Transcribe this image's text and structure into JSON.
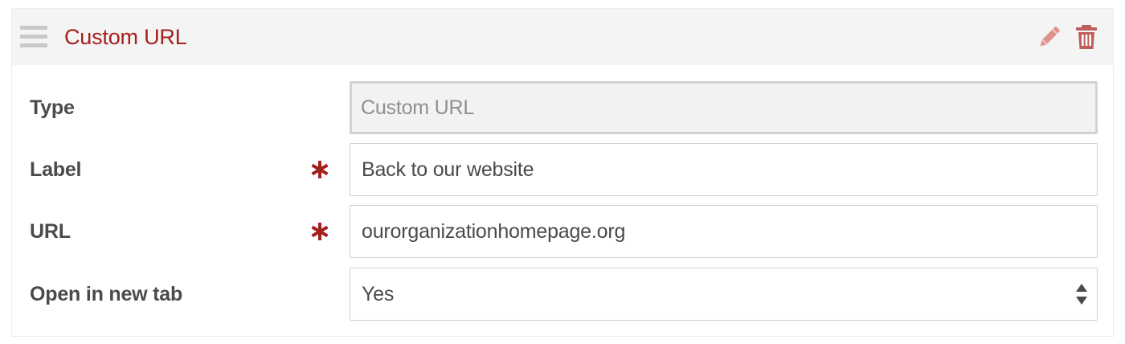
{
  "panel": {
    "title": "Custom URL",
    "icons": {
      "drag": "drag-handle-icon",
      "edit": "pencil-icon",
      "delete": "trash-icon"
    }
  },
  "fields": {
    "type": {
      "label": "Type",
      "value": "Custom URL",
      "readonly": true
    },
    "label": {
      "label": "Label",
      "value": "Back to our website",
      "required": true
    },
    "url": {
      "label": "URL",
      "value": "ourorganizationhomepage.org",
      "required": true
    },
    "new_tab": {
      "label": "Open in new tab",
      "value": "Yes"
    }
  },
  "colors": {
    "accent": "#a4201d",
    "icon_muted": "#e0928f",
    "label": "#4a4a4a",
    "header_bg": "#f4f4f4"
  }
}
